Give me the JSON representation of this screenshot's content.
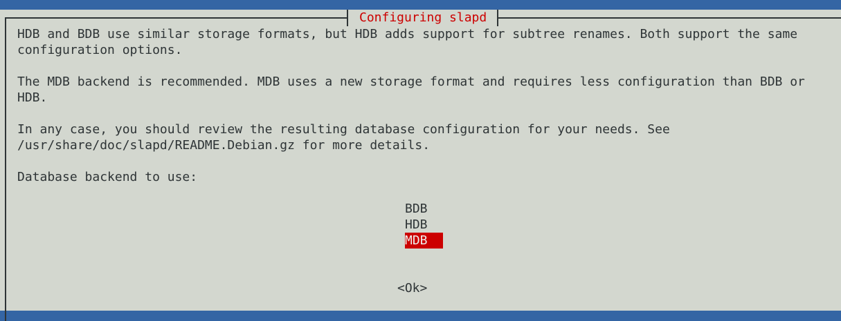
{
  "dialog": {
    "title": "Configuring slapd",
    "paragraphs": [
      "HDB and BDB use similar storage formats, but HDB adds support for subtree renames. Both support the same\nconfiguration options.",
      "The MDB backend is recommended. MDB uses a new storage format and requires less configuration than BDB or\nHDB.",
      "In any case, you should review the resulting database configuration for your needs. See\n/usr/share/doc/slapd/README.Debian.gz for more details.",
      "Database backend to use:"
    ],
    "options": [
      "BDB",
      "HDB",
      "MDB"
    ],
    "selected_option": "MDB",
    "ok_label": "<Ok>"
  },
  "colors": {
    "background": "#3465a4",
    "dialog": "#d3d7cf",
    "title": "#cc0000",
    "selection": "#cc0000",
    "text": "#2e3436"
  }
}
